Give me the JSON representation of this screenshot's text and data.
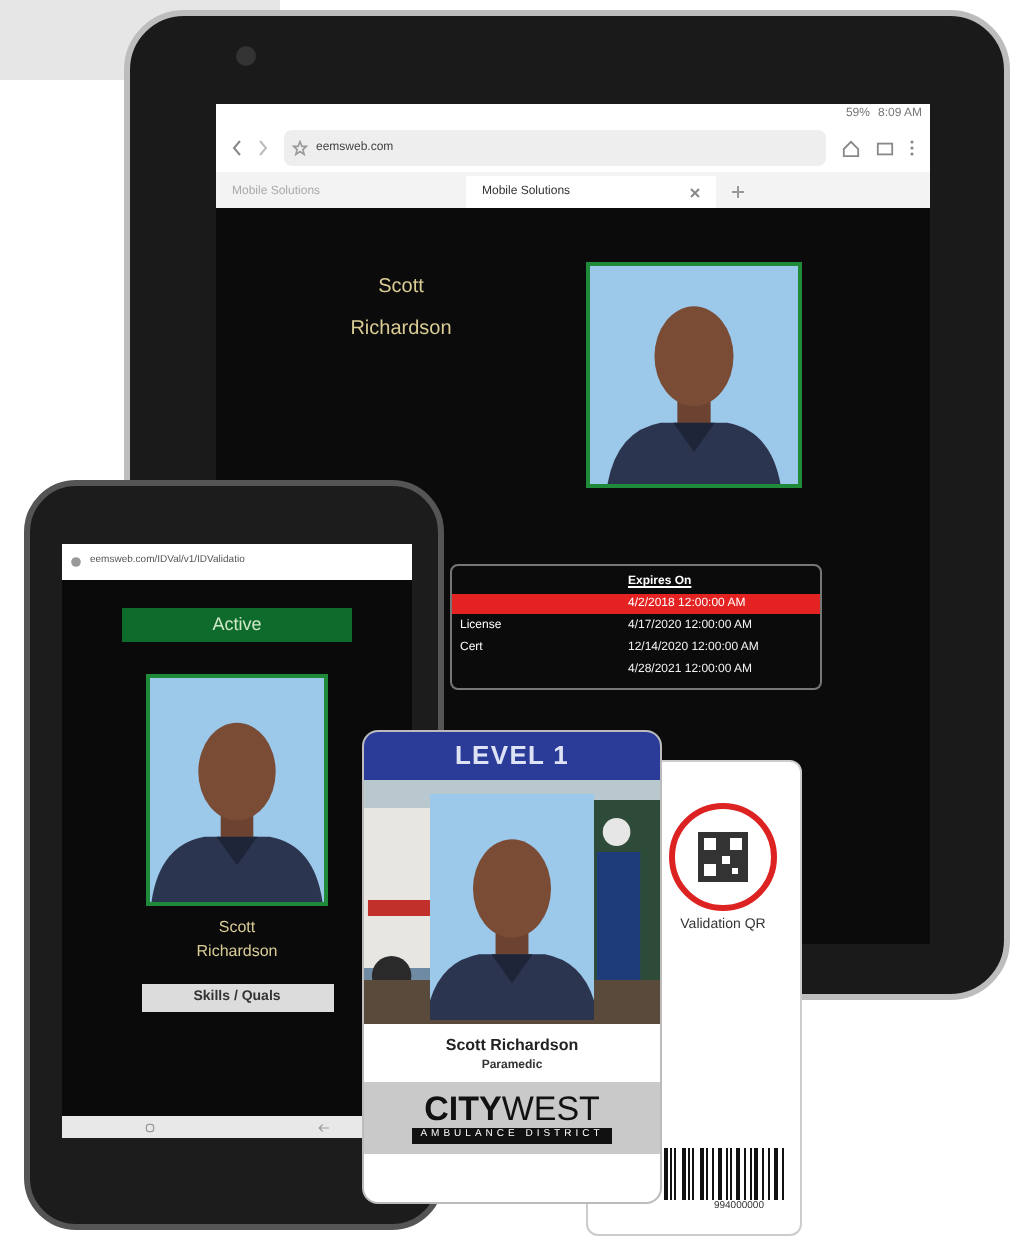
{
  "tablet": {
    "status_bar": {
      "battery": "59%",
      "time": "8:09 AM"
    },
    "address_bar": {
      "url": "eemsweb.com"
    },
    "tabs": [
      {
        "label": "Mobile Solutions",
        "selected": false
      },
      {
        "label": "Mobile Solutions",
        "selected": true
      }
    ],
    "profile": {
      "name_lines": [
        "Scott",
        "Richardson"
      ]
    },
    "credentials": {
      "column": "Expires On",
      "rows": [
        {
          "expires": "4/2/2018 12:00:00 AM",
          "expired": true
        },
        {
          "label": "License",
          "expires": "4/17/2020 12:00:00 AM",
          "expired": false
        },
        {
          "label": "Cert",
          "expires": "12/14/2020 12:00:00 AM",
          "expired": false
        },
        {
          "expires": "4/28/2021 12:00:00 AM",
          "expired": false
        }
      ]
    }
  },
  "phone": {
    "address_bar": {
      "url": "eemsweb.com/IDVal/v1/IDValidatio"
    },
    "status": {
      "label": "Active",
      "active": true
    },
    "name_lines": [
      "Scott",
      "Richardson"
    ],
    "button": "Skills / Quals"
  },
  "id_card": {
    "header": "LEVEL 1",
    "name": "Scott Richardson",
    "role": "Paramedic",
    "logo": {
      "bold": "CITY",
      "light": "WEST",
      "tagline": "AMBULANCE DISTRICT"
    }
  },
  "card_back": {
    "qr_label": "Validation QR",
    "barcode_number": "994000000"
  }
}
